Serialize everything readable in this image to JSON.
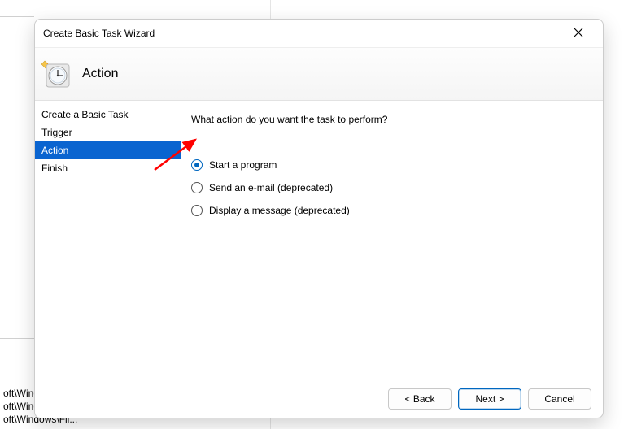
{
  "background": {
    "items": [
      "oft\\Wind...",
      "oft\\Windows\\U...",
      "oft\\Windows\\Fli..."
    ]
  },
  "dialog": {
    "title": "Create Basic Task Wizard",
    "header": "Action",
    "steps": [
      {
        "label": "Create a Basic Task",
        "active": false
      },
      {
        "label": "Trigger",
        "active": false
      },
      {
        "label": "Action",
        "active": true
      },
      {
        "label": "Finish",
        "active": false
      }
    ],
    "prompt": "What action do you want the task to perform?",
    "options": [
      {
        "label": "Start a program",
        "selected": true
      },
      {
        "label": "Send an e-mail (deprecated)",
        "selected": false
      },
      {
        "label": "Display a message (deprecated)",
        "selected": false
      }
    ],
    "buttons": {
      "back": "< Back",
      "next": "Next >",
      "cancel": "Cancel"
    }
  }
}
